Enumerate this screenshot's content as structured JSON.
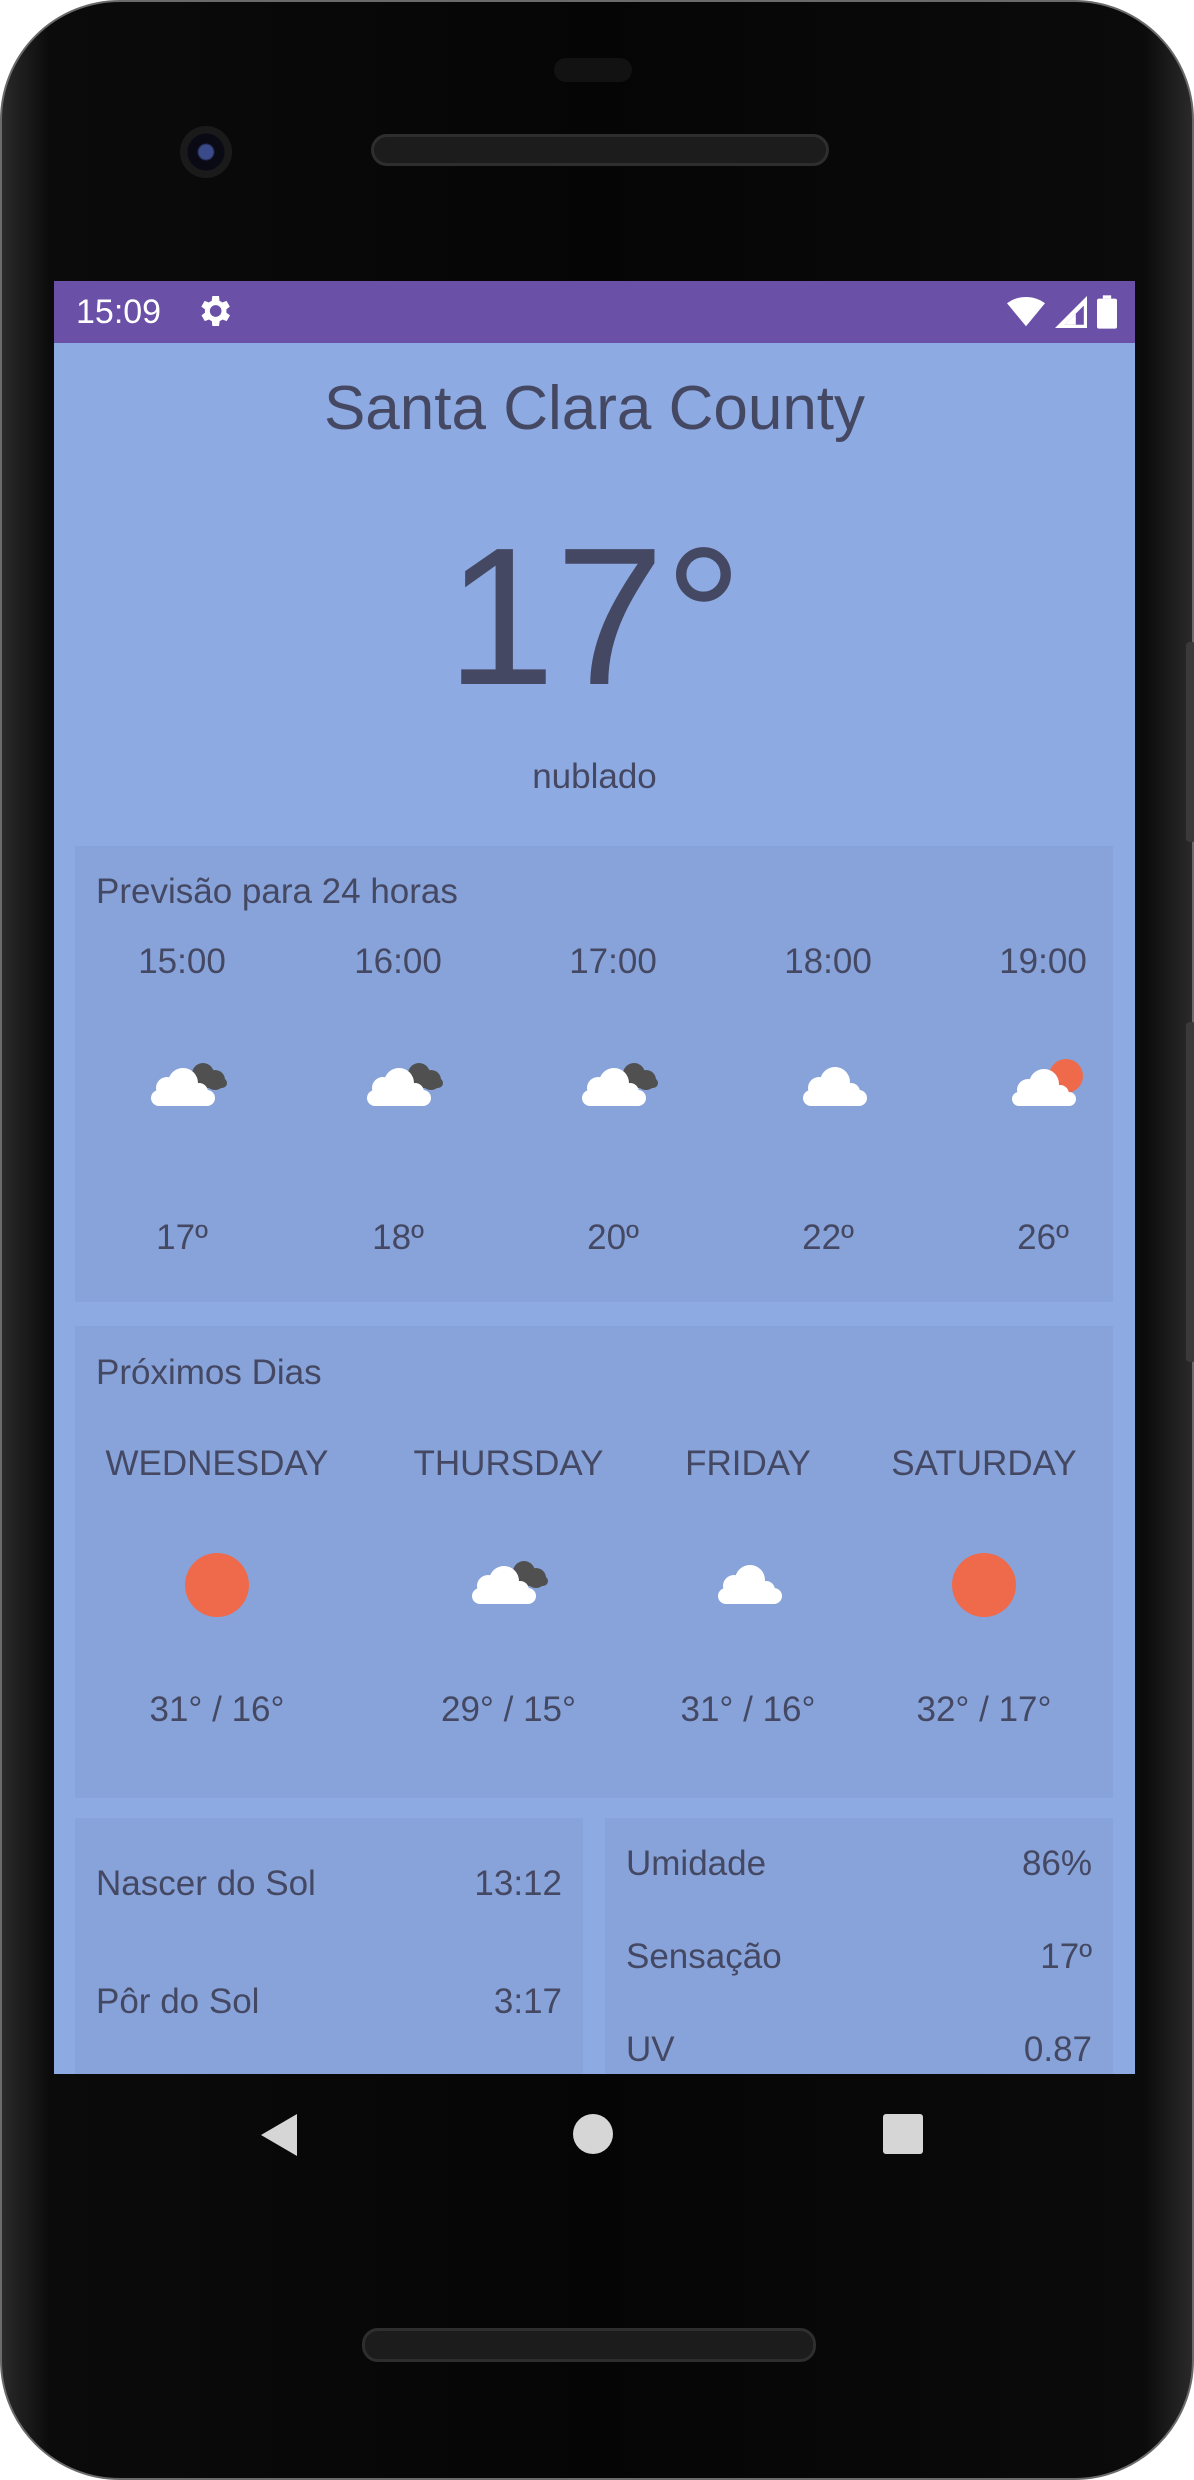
{
  "status_bar": {
    "time": "15:09",
    "icons": [
      "gear-icon",
      "wifi-icon",
      "signal-icon",
      "battery-icon"
    ]
  },
  "location": "Santa Clara County",
  "current": {
    "temperature": "17°",
    "condition": "nublado"
  },
  "hourly": {
    "title": "Previsão para 24 horas",
    "items": [
      {
        "time": "15:00",
        "icon": "cloudy-icon",
        "temp": "17º"
      },
      {
        "time": "16:00",
        "icon": "cloudy-icon",
        "temp": "18º"
      },
      {
        "time": "17:00",
        "icon": "cloudy-icon",
        "temp": "20º"
      },
      {
        "time": "18:00",
        "icon": "cloud-icon",
        "temp": "22º"
      },
      {
        "time": "19:00",
        "icon": "partly-sunny-icon",
        "temp": "26º"
      }
    ]
  },
  "daily": {
    "title": "Próximos Dias",
    "items": [
      {
        "day": "WEDNESDAY",
        "icon": "sun-icon",
        "range": "31° / 16°"
      },
      {
        "day": "THURSDAY",
        "icon": "cloudy-icon",
        "range": "29° / 15°"
      },
      {
        "day": "FRIDAY",
        "icon": "cloud-icon",
        "range": "31° / 16°"
      },
      {
        "day": "SATURDAY",
        "icon": "sun-icon",
        "range": "32° / 17°"
      }
    ]
  },
  "sun": {
    "sunrise_label": "Nascer do Sol",
    "sunrise_value": "13:12",
    "sunset_label": "Pôr do Sol",
    "sunset_value": "3:17"
  },
  "details": {
    "humidity_label": "Umidade",
    "humidity_value": "86%",
    "feels_label": "Sensação",
    "feels_value": "17º",
    "uv_label": "UV",
    "uv_value": "0.87"
  },
  "colors": {
    "status_bar": "#6a50a7",
    "background": "#8eaae2",
    "card": "#87a3da",
    "text": "#454862",
    "sun": "#ee6a4a"
  },
  "nav_bar": {
    "icons": [
      "back-icon",
      "home-icon",
      "recents-icon"
    ]
  }
}
